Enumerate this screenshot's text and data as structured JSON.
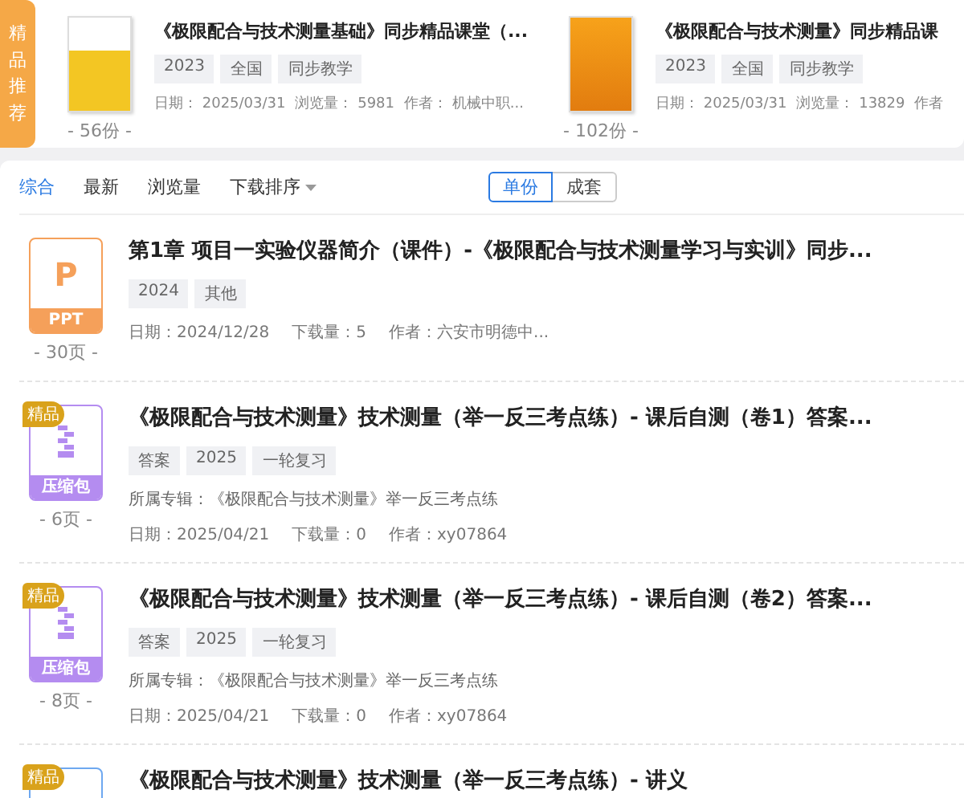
{
  "featured": {
    "label": "精品推荐",
    "cards": [
      {
        "pages": "- 56份 -",
        "title": "《极限配合与技术测量基础》同步精品课堂（...",
        "tags": [
          "2023",
          "全国",
          "同步教学"
        ],
        "meta": [
          "日期： 2025/03/31",
          "浏览量： 5981",
          "作者： 机械中职..."
        ]
      },
      {
        "pages": "- 102份 -",
        "title": "《极限配合与技术测量》同步精品课",
        "tags": [
          "2023",
          "全国",
          "同步教学"
        ],
        "meta": [
          "日期： 2025/03/31",
          "浏览量： 13829",
          "作者"
        ]
      }
    ]
  },
  "filters": [
    {
      "label": "综合",
      "selected": true
    },
    {
      "label": "最新",
      "selected": false
    },
    {
      "label": "浏览量",
      "selected": false
    }
  ],
  "sort": {
    "label": "下载排序"
  },
  "toggle": [
    {
      "label": "单份",
      "selected": true
    },
    {
      "label": "成套",
      "selected": false
    }
  ],
  "items": [
    {
      "kind": "ppt",
      "icon_label": "PPT",
      "icon_letter": "P",
      "pages": "- 30页 -",
      "title": "第1章 项目一实验仪器简介（课件）-《极限配合与技术测量学习与实训》同步...",
      "tags": [
        "2024",
        "其他"
      ],
      "meta": [
        "日期：2024/12/28",
        "下载量：5",
        "作者：六安市明德中..."
      ]
    },
    {
      "kind": "zip",
      "badge": "精品",
      "icon_label": "压缩包",
      "pages": "- 6页 -",
      "title": "《极限配合与技术测量》技术测量（举一反三考点练）- 课后自测（卷1）答案...",
      "tags": [
        "答案",
        "2025",
        "一轮复习"
      ],
      "album": "所属专辑：《极限配合与技术测量》举一反三考点练",
      "meta": [
        "日期：2025/04/21",
        "下载量：0",
        "作者：xy07864"
      ]
    },
    {
      "kind": "zip",
      "badge": "精品",
      "icon_label": "压缩包",
      "pages": "- 8页 -",
      "title": "《极限配合与技术测量》技术测量（举一反三考点练）- 课后自测（卷2）答案...",
      "tags": [
        "答案",
        "2025",
        "一轮复习"
      ],
      "album": "所属专辑：《极限配合与技术测量》举一反三考点练",
      "meta": [
        "日期：2025/04/21",
        "下载量：0",
        "作者：xy07864"
      ]
    },
    {
      "kind": "doc",
      "badge": "精品",
      "title": "《极限配合与技术测量》技术测量（举一反三考点练）- 讲义"
    }
  ]
}
